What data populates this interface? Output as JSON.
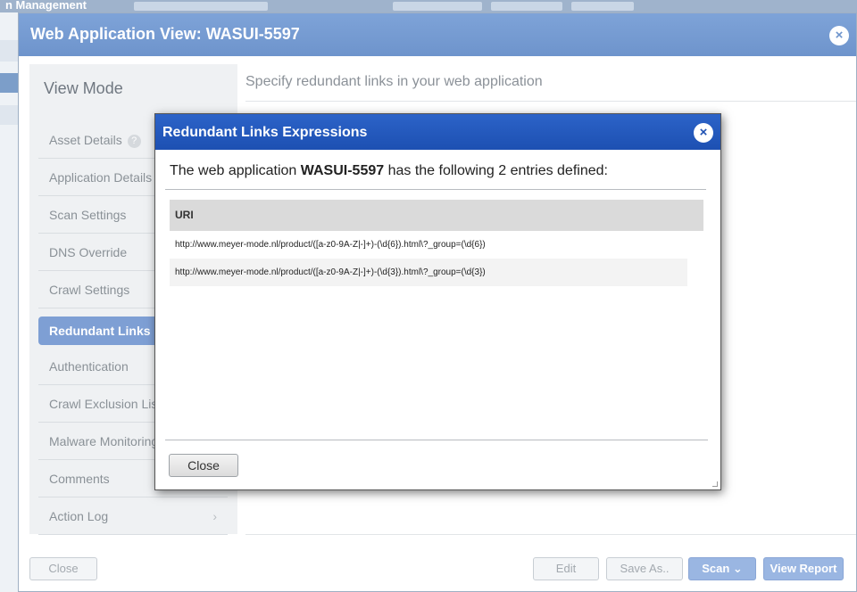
{
  "background": {
    "topbar_text": "n Management"
  },
  "dialog": {
    "title": "Web Application View: WASUI-5597",
    "close_icon": "×",
    "sidebar": {
      "heading": "View Mode",
      "items": [
        {
          "label": "Asset Details"
        },
        {
          "label": "Application Details"
        },
        {
          "label": "Scan Settings"
        },
        {
          "label": "DNS Override"
        },
        {
          "label": "Crawl Settings"
        },
        {
          "label": "Redundant Links"
        },
        {
          "label": "Authentication"
        },
        {
          "label": "Crawl Exclusion Lists"
        },
        {
          "label": "Malware Monitoring"
        },
        {
          "label": "Comments"
        },
        {
          "label": "Action Log"
        }
      ],
      "help_icon": "?",
      "chevron_icon": "›"
    },
    "main_heading": "Specify redundant links in your web application",
    "footer": {
      "close": "Close",
      "edit": "Edit",
      "save_as": "Save As..",
      "scan": "Scan",
      "scan_chevron": "⌄",
      "view_report": "View Report"
    }
  },
  "modal": {
    "title": "Redundant Links Expressions",
    "close_icon": "×",
    "intro_prefix": "The web application ",
    "intro_name": "WASUI-5597",
    "intro_suffix": " has the following 2 entries defined:",
    "table": {
      "header": "URI",
      "rows": [
        "http://www.meyer-mode.nl/product/([a-z0-9A-Z|-]+)-(\\d{6}).html\\?_group=(\\d{6})",
        "http://www.meyer-mode.nl/product/([a-z0-9A-Z|-]+)-(\\d{3}).html\\?_group=(\\d{3})"
      ]
    },
    "close_button": "Close"
  }
}
